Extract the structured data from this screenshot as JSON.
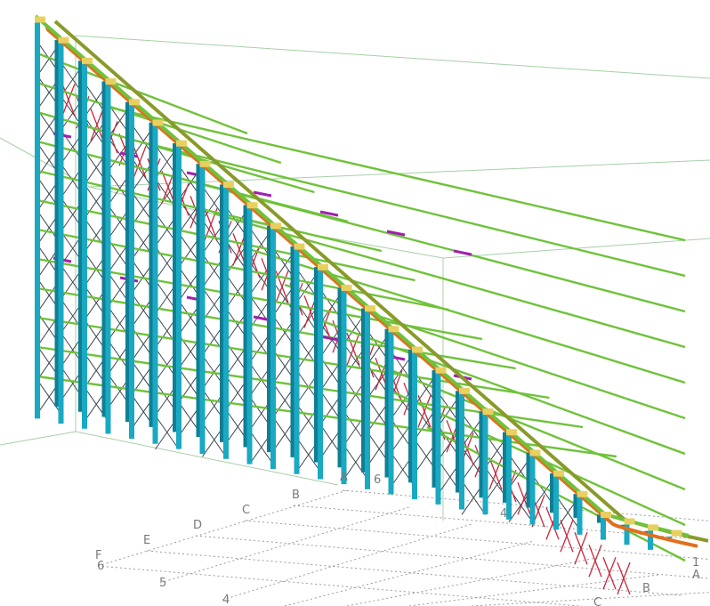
{
  "view": {
    "background": "#ffffff",
    "colors": {
      "column": "#1aa9c2",
      "column_dark": "#0f7f95",
      "bracing": "#3a4750",
      "beam": "#6fc23a",
      "top_chord": "#8a9a2a",
      "rail": "#e0701e",
      "node": "#e8d060",
      "truss": "#c8283c",
      "brace_purple": "#a020b0",
      "grid_line": "#9a9a9a",
      "bounding_box": "#a8cfa8"
    }
  },
  "grid_labels": {
    "letters_upper": [
      "A",
      "B",
      "C",
      "D",
      "E",
      "F"
    ],
    "numbers_left": [
      "6",
      "5",
      "4"
    ],
    "numbers_right": [
      "6",
      "4",
      "1"
    ],
    "letters_lower": [
      "A",
      "B",
      "C"
    ]
  }
}
